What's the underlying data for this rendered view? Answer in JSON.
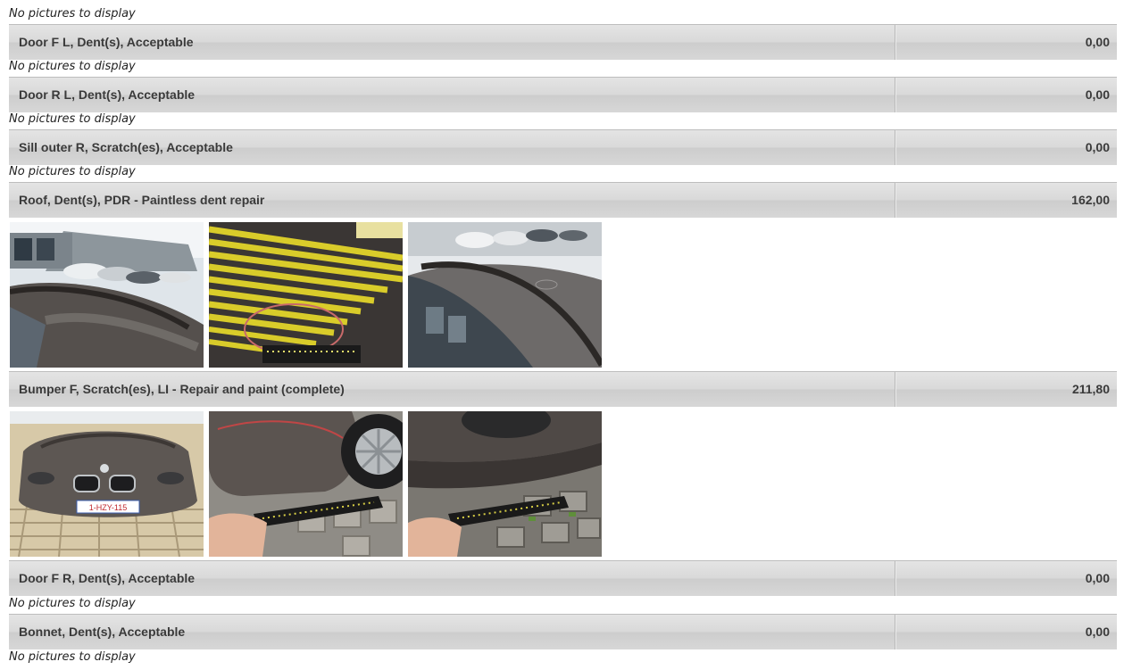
{
  "no_pictures_text": "No pictures to display",
  "damages": [
    {
      "description": "Door F L, Dent(s), Acceptable",
      "amount": "0,00"
    },
    {
      "description": "Door R L, Dent(s), Acceptable",
      "amount": "0,00"
    },
    {
      "description": "Sill outer R, Scratch(es), Acceptable",
      "amount": "0,00"
    },
    {
      "description": "Roof, Dent(s), PDR - Paintless dent repair",
      "amount": "162,00"
    },
    {
      "description": "Bumper F, Scratch(es), LI - Repair and paint (complete)",
      "amount": "211,80"
    },
    {
      "description": "Door F R, Dent(s), Acceptable",
      "amount": "0,00"
    },
    {
      "description": "Bonnet, Dent(s), Acceptable",
      "amount": "0,00"
    }
  ],
  "plate_text": "1-HZY-115"
}
